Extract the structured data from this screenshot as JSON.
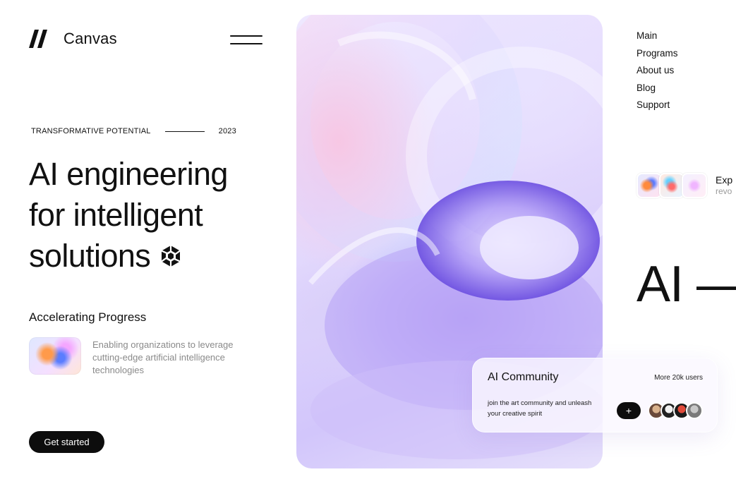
{
  "brand": {
    "name": "Canvas",
    "logo_icon": "double-slash-logo-icon",
    "menu_icon": "hamburger-menu-icon"
  },
  "intro": {
    "eyebrow_left": "TRANSFORMATIVE POTENTIAL",
    "eyebrow_year": "2023",
    "headline": [
      "AI engineering",
      "for intelligent",
      "solutions"
    ],
    "headline_icon": "hexagon-aperture-icon"
  },
  "feature": {
    "title": "Accelerating Progress",
    "description": "Enabling organizations to leverage cutting-edge artificial intelligence technologies"
  },
  "cta": {
    "label": "Get started"
  },
  "nav": {
    "items": [
      "Main",
      "Programs",
      "About us",
      "Blog",
      "Support"
    ]
  },
  "explore": {
    "title": "Exp",
    "subtitle": "revo"
  },
  "big_heading": "AI —",
  "community": {
    "title": "AI Community",
    "users": "More 20k users",
    "description": "join the art community and unleash your creative spirit",
    "join_label": "+",
    "avatar_count": 4
  },
  "colors": {
    "text": "#111111",
    "button_bg": "#0d0d0d",
    "muted_text": "#8a8a8a",
    "hero_accent": "#8a6cf0"
  }
}
